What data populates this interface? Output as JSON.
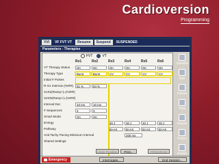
{
  "header": {
    "title": "Cardioversion",
    "subtitle": "Programming"
  },
  "toolbar": {
    "tabs": [
      "VVI",
      "VF FVT VT",
      "Resume",
      "Suspend",
      "SUSPENDED"
    ]
  },
  "panel": {
    "title": "Parameters - Therapies",
    "fvt_label": "FVT",
    "vt_label": "VT",
    "columns": [
      "Rx1",
      "Rx2",
      "Rx3",
      "Rx4",
      "Rx5",
      "Rx6"
    ],
    "rows": [
      {
        "label": "VT Therapy Status",
        "cells": [
          "On",
          "On",
          "On",
          "On",
          "On",
          "On"
        ]
      },
      {
        "label": "Therapy Type",
        "cells": [
          "Burst",
          "Burst",
          "CV",
          "CV",
          "CV",
          "CV"
        ]
      },
      {
        "label": "Initial # Pulses",
        "cells": []
      },
      {
        "label": "R-S1 Interval=(%RR)",
        "cells": [
          "91 %",
          "84 %"
        ]
      },
      {
        "label": "S1S2(Ramp+)=(%RR)",
        "cells": []
      },
      {
        "label": "S2SN(Ramp+)=(%RR)",
        "cells": []
      },
      {
        "label": "Interval Dec",
        "cells": [
          "10 ms",
          "10 ms"
        ]
      },
      {
        "label": "# Sequences",
        "cells": [
          "3",
          "3"
        ]
      },
      {
        "label": "Smart Mode",
        "cells": [
          "On",
          "On"
        ]
      },
      {
        "label": "Energy",
        "cells": [
          "",
          "",
          "30 J",
          "30 J",
          "30 J",
          "30 J"
        ]
      },
      {
        "label": "Pathway",
        "cells": [
          "",
          "",
          "B>AX",
          "B>AX",
          "B>AX",
          "B>AX"
        ]
      },
      {
        "label": "Anti-Tachy Pacing Minimum Interval",
        "cells": [
          "200 ms"
        ]
      },
      {
        "label": "Shared Settings",
        "cells": []
      }
    ],
    "buttons": {
      "undo": "Undo Pending",
      "print": "Print...",
      "program": "PROGRAM"
    }
  },
  "sidebar": {
    "items": [
      "Checklist",
      "Data",
      "Params",
      "Tests",
      "Reports",
      "Patient",
      "Session"
    ]
  },
  "bottom": {
    "emergency": "Emergency",
    "interrogate": "Interrogate...",
    "end": "End Session..."
  }
}
